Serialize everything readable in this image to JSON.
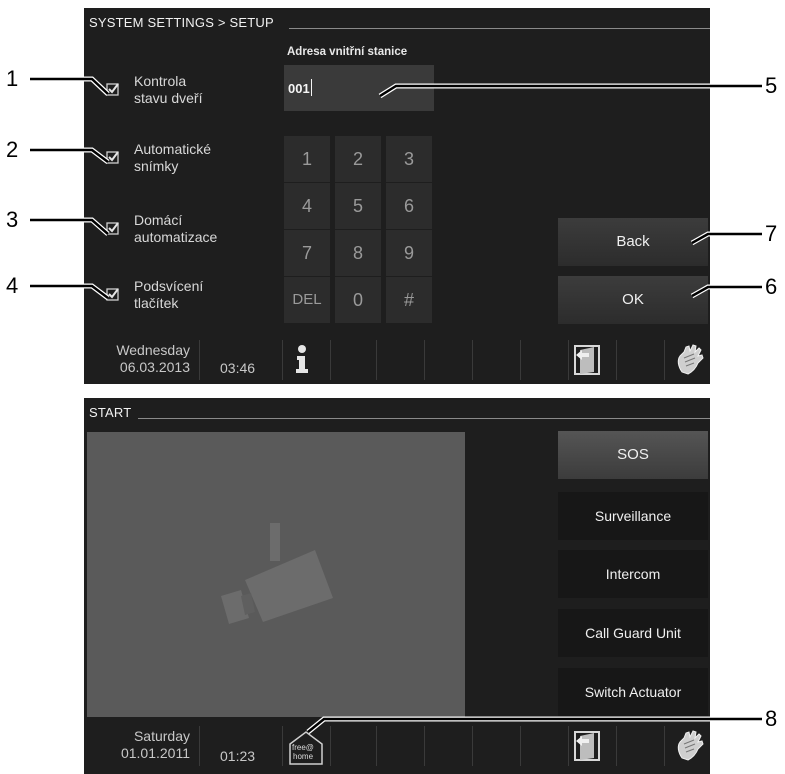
{
  "setup_panel": {
    "title": "SYSTEM SETTINGS > SETUP",
    "checkboxes": [
      {
        "line1": "Kontrola",
        "line2": "stavu dveří",
        "checked": true
      },
      {
        "line1": "Automatické",
        "line2": "snímky",
        "checked": true
      },
      {
        "line1": "Domácí",
        "line2": "automatizace",
        "checked": true
      },
      {
        "line1": "Podsvícení",
        "line2": "tlačítek",
        "checked": true
      }
    ],
    "address_label": "Adresa vnitřní stanice",
    "address_value": "001",
    "keypad": [
      "1",
      "2",
      "3",
      "4",
      "5",
      "6",
      "7",
      "8",
      "9",
      "DEL",
      "0",
      "#"
    ],
    "back_label": "Back",
    "ok_label": "OK",
    "statusbar": {
      "day": "Wednesday",
      "date": "06.03.2013",
      "time": "03:46",
      "icons": [
        "info-icon",
        "back-door-icon",
        "hand-icon"
      ]
    }
  },
  "start_panel": {
    "title": "START",
    "camera_icon": "camera-placeholder-icon",
    "buttons": [
      "SOS",
      "Surveillance",
      "Intercom",
      "Call Guard Unit",
      "Switch Actuator"
    ],
    "statusbar": {
      "day": "Saturday",
      "date": "01.01.2011",
      "time": "01:23",
      "icons": [
        "free-at-home-icon",
        "back-door-icon",
        "hand-icon"
      ],
      "home_icon_text1": "free@",
      "home_icon_text2": "home"
    }
  },
  "callouts": [
    "1",
    "2",
    "3",
    "4",
    "5",
    "6",
    "7",
    "8"
  ]
}
